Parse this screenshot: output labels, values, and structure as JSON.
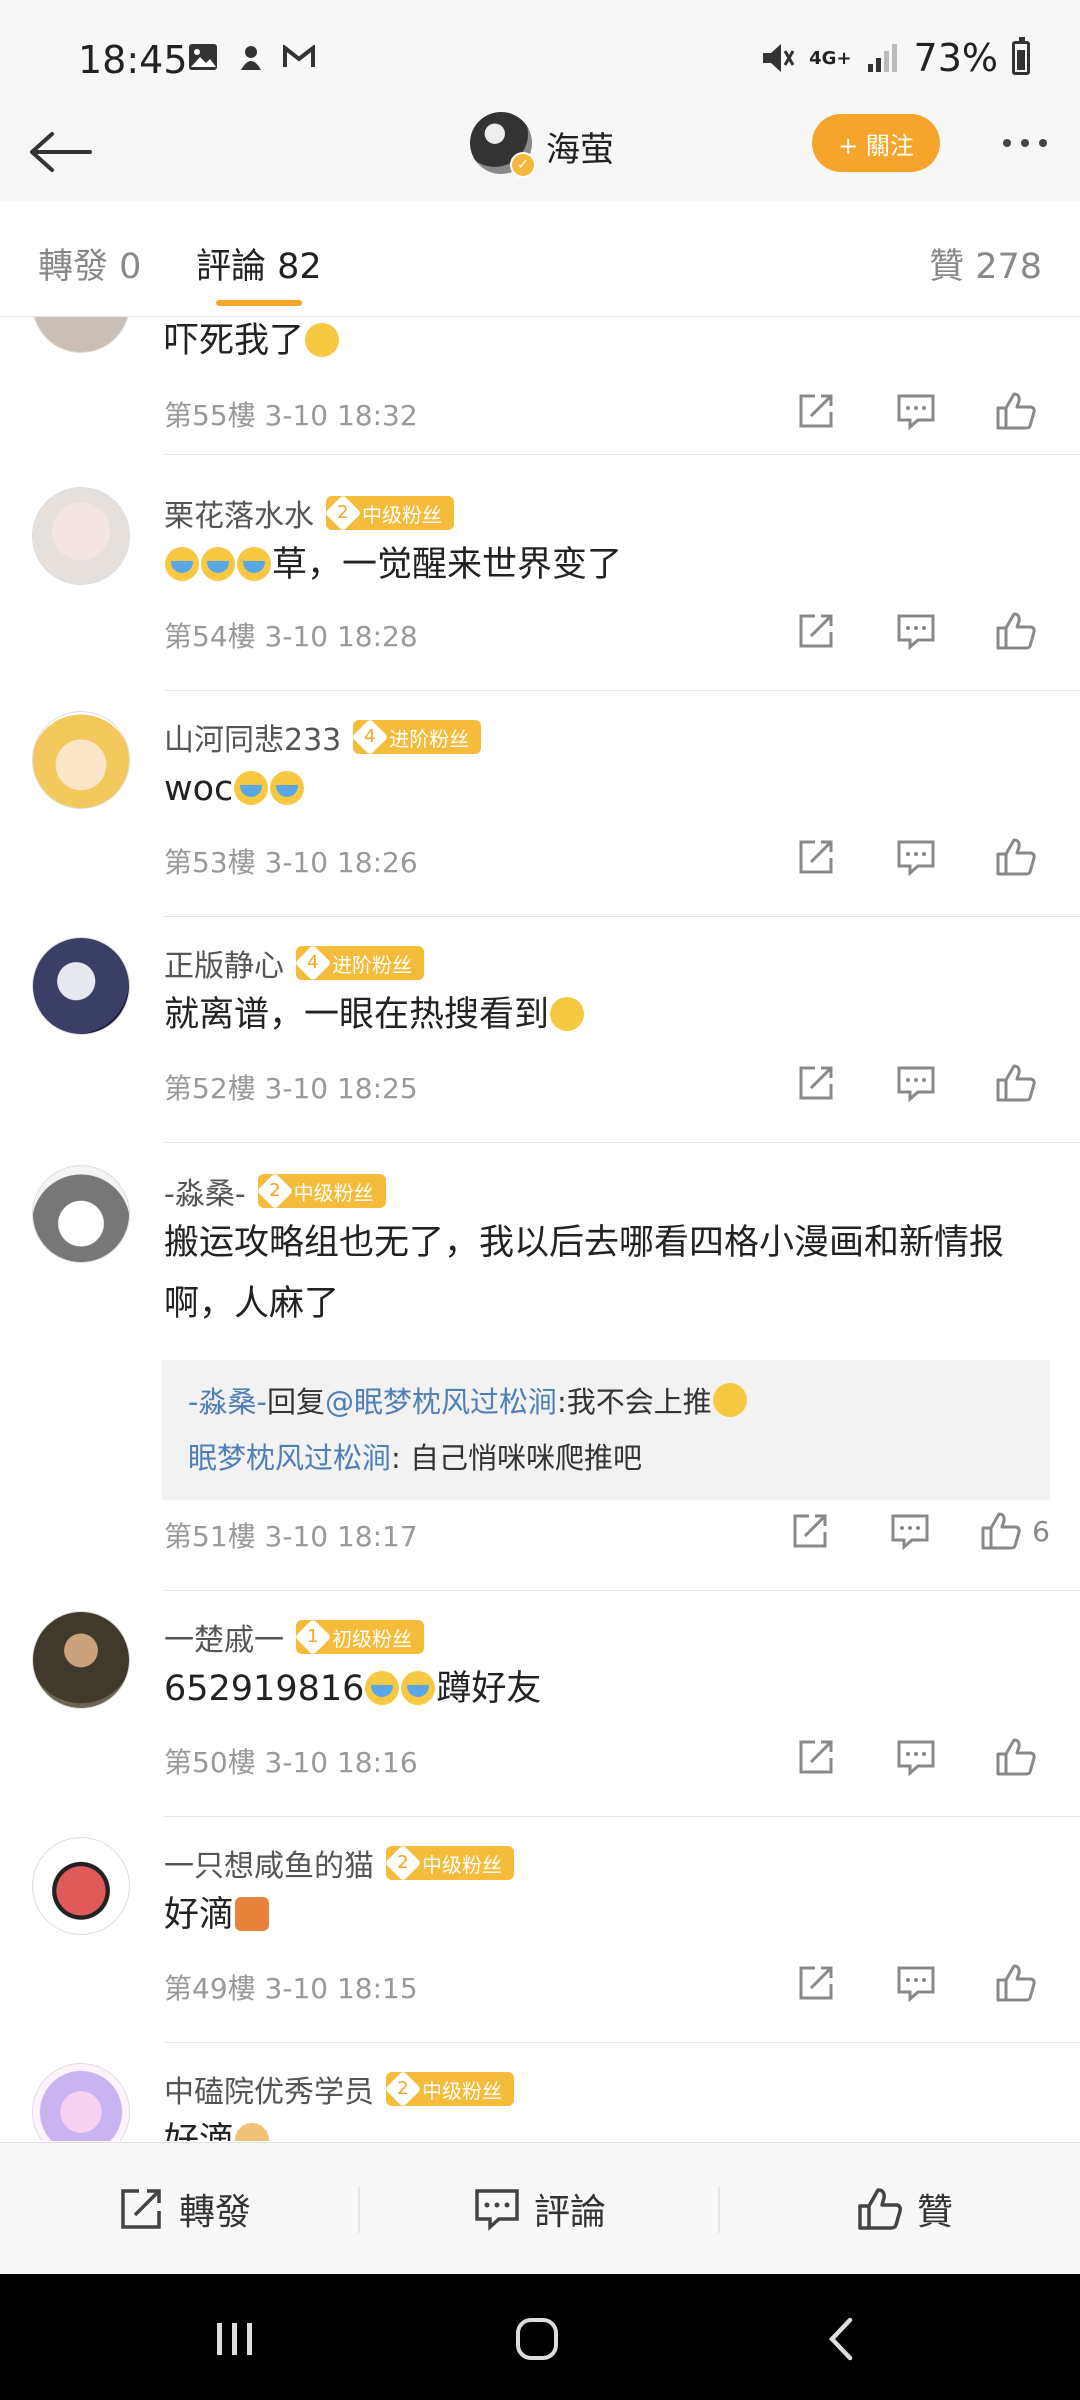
{
  "status": {
    "time": "18:45",
    "net": "4G+",
    "battery": "73%"
  },
  "header": {
    "title": "海萤",
    "follow": "+ 關注"
  },
  "tabs": [
    {
      "label": "轉發 0"
    },
    {
      "label": "評論 82"
    },
    {
      "label": "贊 278"
    }
  ],
  "comments": [
    {
      "name": "",
      "badge_level": "",
      "badge": "",
      "text": "吓死我了",
      "meta": "第55樓 3-10 18:32",
      "likes": ""
    },
    {
      "name": "栗花落水水",
      "badge_level": "2",
      "badge": "中级粉丝",
      "text": "草，一觉醒来世界变了",
      "meta": "第54樓 3-10 18:28",
      "likes": ""
    },
    {
      "name": "山河同悲233",
      "badge_level": "4",
      "badge": "进阶粉丝",
      "text": "woc",
      "meta": "第53樓 3-10 18:26",
      "likes": ""
    },
    {
      "name": "正版静心",
      "badge_level": "4",
      "badge": "进阶粉丝",
      "text": "就离谱，一眼在热搜看到",
      "meta": "第52樓 3-10 18:25",
      "likes": ""
    },
    {
      "name": "-淼桑-",
      "badge_level": "2",
      "badge": "中级粉丝",
      "text": "搬运攻略组也无了，我以后去哪看四格小漫画和新情报啊，人麻了",
      "meta": "第51樓 3-10 18:17",
      "likes": "6"
    },
    {
      "name": "一楚戚一",
      "badge_level": "1",
      "badge": "初级粉丝",
      "text": "652919816",
      "text2": "蹲好友",
      "meta": "第50樓 3-10 18:16",
      "likes": ""
    },
    {
      "name": "一只想咸鱼的猫",
      "badge_level": "2",
      "badge": "中级粉丝",
      "text": "好滴",
      "meta": "第49樓 3-10 18:15",
      "likes": ""
    },
    {
      "name": "中磕院优秀学员",
      "badge_level": "2",
      "badge": "中级粉丝",
      "text": "好滴",
      "meta": "",
      "likes": ""
    }
  ],
  "reply": {
    "line1_user": "-淼桑-",
    "line1_mid": "回复",
    "line1_at": "@眠梦枕风过松涧",
    "line1_text": ":我不会上推",
    "line2_user": "眠梦枕风过松涧",
    "line2_text": ": 自己悄咪咪爬推吧"
  },
  "bottom": {
    "repost": "轉發",
    "comment": "評論",
    "like": "贊"
  }
}
